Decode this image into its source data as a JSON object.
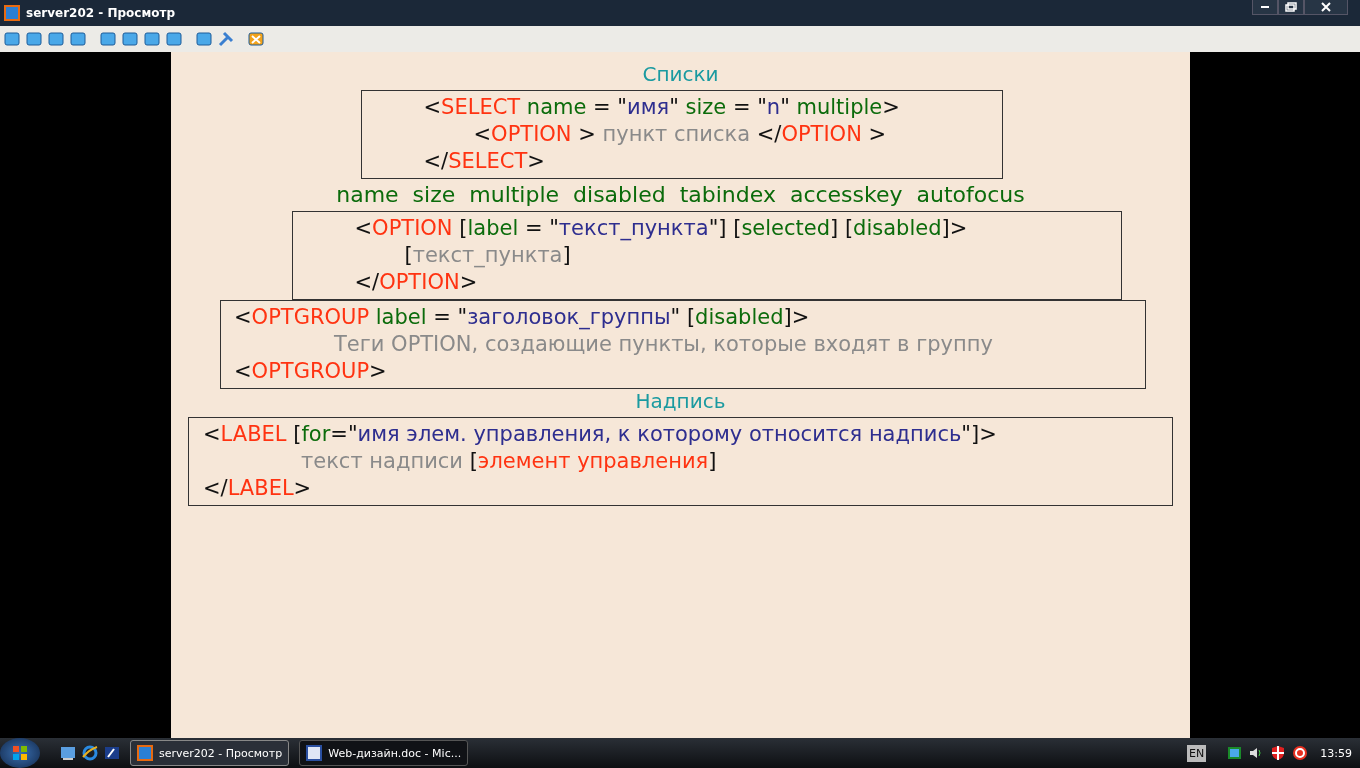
{
  "window": {
    "title": "server202 - Просмотр"
  },
  "slide": {
    "items": [
      {
        "kind": "heading",
        "text": "Списки"
      },
      {
        "kind": "code",
        "lines": [
          {
            "segments": [
              {
                "kind": "punct",
                "text": "<"
              },
              {
                "kind": "tag",
                "text": "SELECT"
              },
              {
                "kind": "attr",
                "text": " name"
              },
              {
                "kind": "punct",
                "text": " = \""
              },
              {
                "kind": "value",
                "text": "имя"
              },
              {
                "kind": "punct",
                "text": "\" "
              },
              {
                "kind": "attr",
                "text": "size"
              },
              {
                "kind": "punct",
                "text": " = \""
              },
              {
                "kind": "value",
                "text": "n"
              },
              {
                "kind": "punct",
                "text": "\" "
              },
              {
                "kind": "attr",
                "text": "multiple"
              },
              {
                "kind": "punct",
                "text": ">"
              }
            ],
            "children": [
              {
                "segments": [
                  {
                    "kind": "punct",
                    "text": "<"
                  },
                  {
                    "kind": "tag",
                    "text": "OPTION"
                  },
                  {
                    "kind": "punct",
                    "text": " > "
                  },
                  {
                    "kind": "text",
                    "text": "пункт списка"
                  },
                  {
                    "kind": "punct",
                    "text": " </"
                  },
                  {
                    "kind": "tag",
                    "text": "OPTION"
                  },
                  {
                    "kind": "punct",
                    "text": " >"
                  }
                ]
              }
            ]
          },
          {
            "segments": [
              {
                "kind": "punct",
                "text": "</"
              },
              {
                "kind": "tag",
                "text": "SELECT"
              },
              {
                "kind": "punct",
                "text": ">"
              }
            ]
          }
        ]
      },
      {
        "kind": "attributes",
        "text": "name  size  multiple  disabled  tabindex  accesskey  autofocus"
      },
      {
        "kind": "code",
        "lines": [
          {
            "segments": [
              {
                "kind": "punct",
                "text": "<"
              },
              {
                "kind": "tag",
                "text": "OPTION"
              },
              {
                "kind": "punct",
                "text": " ["
              },
              {
                "kind": "attr",
                "text": "label"
              },
              {
                "kind": "punct",
                "text": " = \""
              },
              {
                "kind": "value",
                "text": "текст_пункта"
              },
              {
                "kind": "punct",
                "text": "\"] ["
              },
              {
                "kind": "attr",
                "text": "selected"
              },
              {
                "kind": "punct",
                "text": "] ["
              },
              {
                "kind": "attr",
                "text": "disabled"
              },
              {
                "kind": "punct",
                "text": "]>"
              }
            ],
            "children": [
              {
                "segments": [
                  {
                    "kind": "punct",
                    "text": "["
                  },
                  {
                    "kind": "text",
                    "text": "текст_пункта"
                  },
                  {
                    "kind": "punct",
                    "text": "]"
                  }
                ]
              }
            ]
          },
          {
            "segments": [
              {
                "kind": "punct",
                "text": "</"
              },
              {
                "kind": "tag",
                "text": "OPTION"
              },
              {
                "kind": "punct",
                "text": ">"
              }
            ]
          }
        ]
      },
      {
        "kind": "code",
        "lines": [
          {
            "segments": [
              {
                "kind": "punct",
                "text": "<"
              },
              {
                "kind": "tag",
                "text": "OPTGROUP"
              },
              {
                "kind": "attr",
                "text": " label"
              },
              {
                "kind": "punct",
                "text": " = \""
              },
              {
                "kind": "value",
                "text": "заголовок_группы"
              },
              {
                "kind": "punct",
                "text": "\" ["
              },
              {
                "kind": "attr",
                "text": "disabled"
              },
              {
                "kind": "punct",
                "text": "]>"
              }
            ],
            "children": [
              {
                "segments": [
                  {
                    "kind": "text",
                    "text": "Теги OPTION, создающие пункты, которые входят в группу"
                  }
                ]
              }
            ]
          },
          {
            "segments": [
              {
                "kind": "punct",
                "text": "<"
              },
              {
                "kind": "tag",
                "text": "OPTGROUP"
              },
              {
                "kind": "punct",
                "text": ">"
              }
            ]
          }
        ]
      },
      {
        "kind": "heading",
        "text": "Надпись"
      },
      {
        "kind": "code",
        "lines": [
          {
            "segments": [
              {
                "kind": "punct",
                "text": "<"
              },
              {
                "kind": "tag",
                "text": "LABEL"
              },
              {
                "kind": "punct",
                "text": " ["
              },
              {
                "kind": "attr",
                "text": "for"
              },
              {
                "kind": "punct",
                "text": "=\""
              },
              {
                "kind": "value",
                "text": "имя элем. управления, к которому относится надпись"
              },
              {
                "kind": "punct",
                "text": "\"]>"
              }
            ],
            "children": [
              {
                "segments": [
                  {
                    "kind": "text",
                    "text": "текст надписи "
                  },
                  {
                    "kind": "punct",
                    "text": "["
                  },
                  {
                    "kind": "tag",
                    "text": "элемент управления"
                  },
                  {
                    "kind": "punct",
                    "text": "]"
                  }
                ]
              }
            ]
          },
          {
            "segments": [
              {
                "kind": "punct",
                "text": "</"
              },
              {
                "kind": "tag",
                "text": "LABEL"
              },
              {
                "kind": "punct",
                "text": ">"
              }
            ]
          }
        ]
      }
    ]
  },
  "taskbar": {
    "tasks": [
      {
        "label": "server202 - Просмотр",
        "selected": true
      },
      {
        "label": "Web-дизайн.doc - Mic...",
        "selected": false
      }
    ],
    "language": "EN",
    "clock": "13:59"
  }
}
